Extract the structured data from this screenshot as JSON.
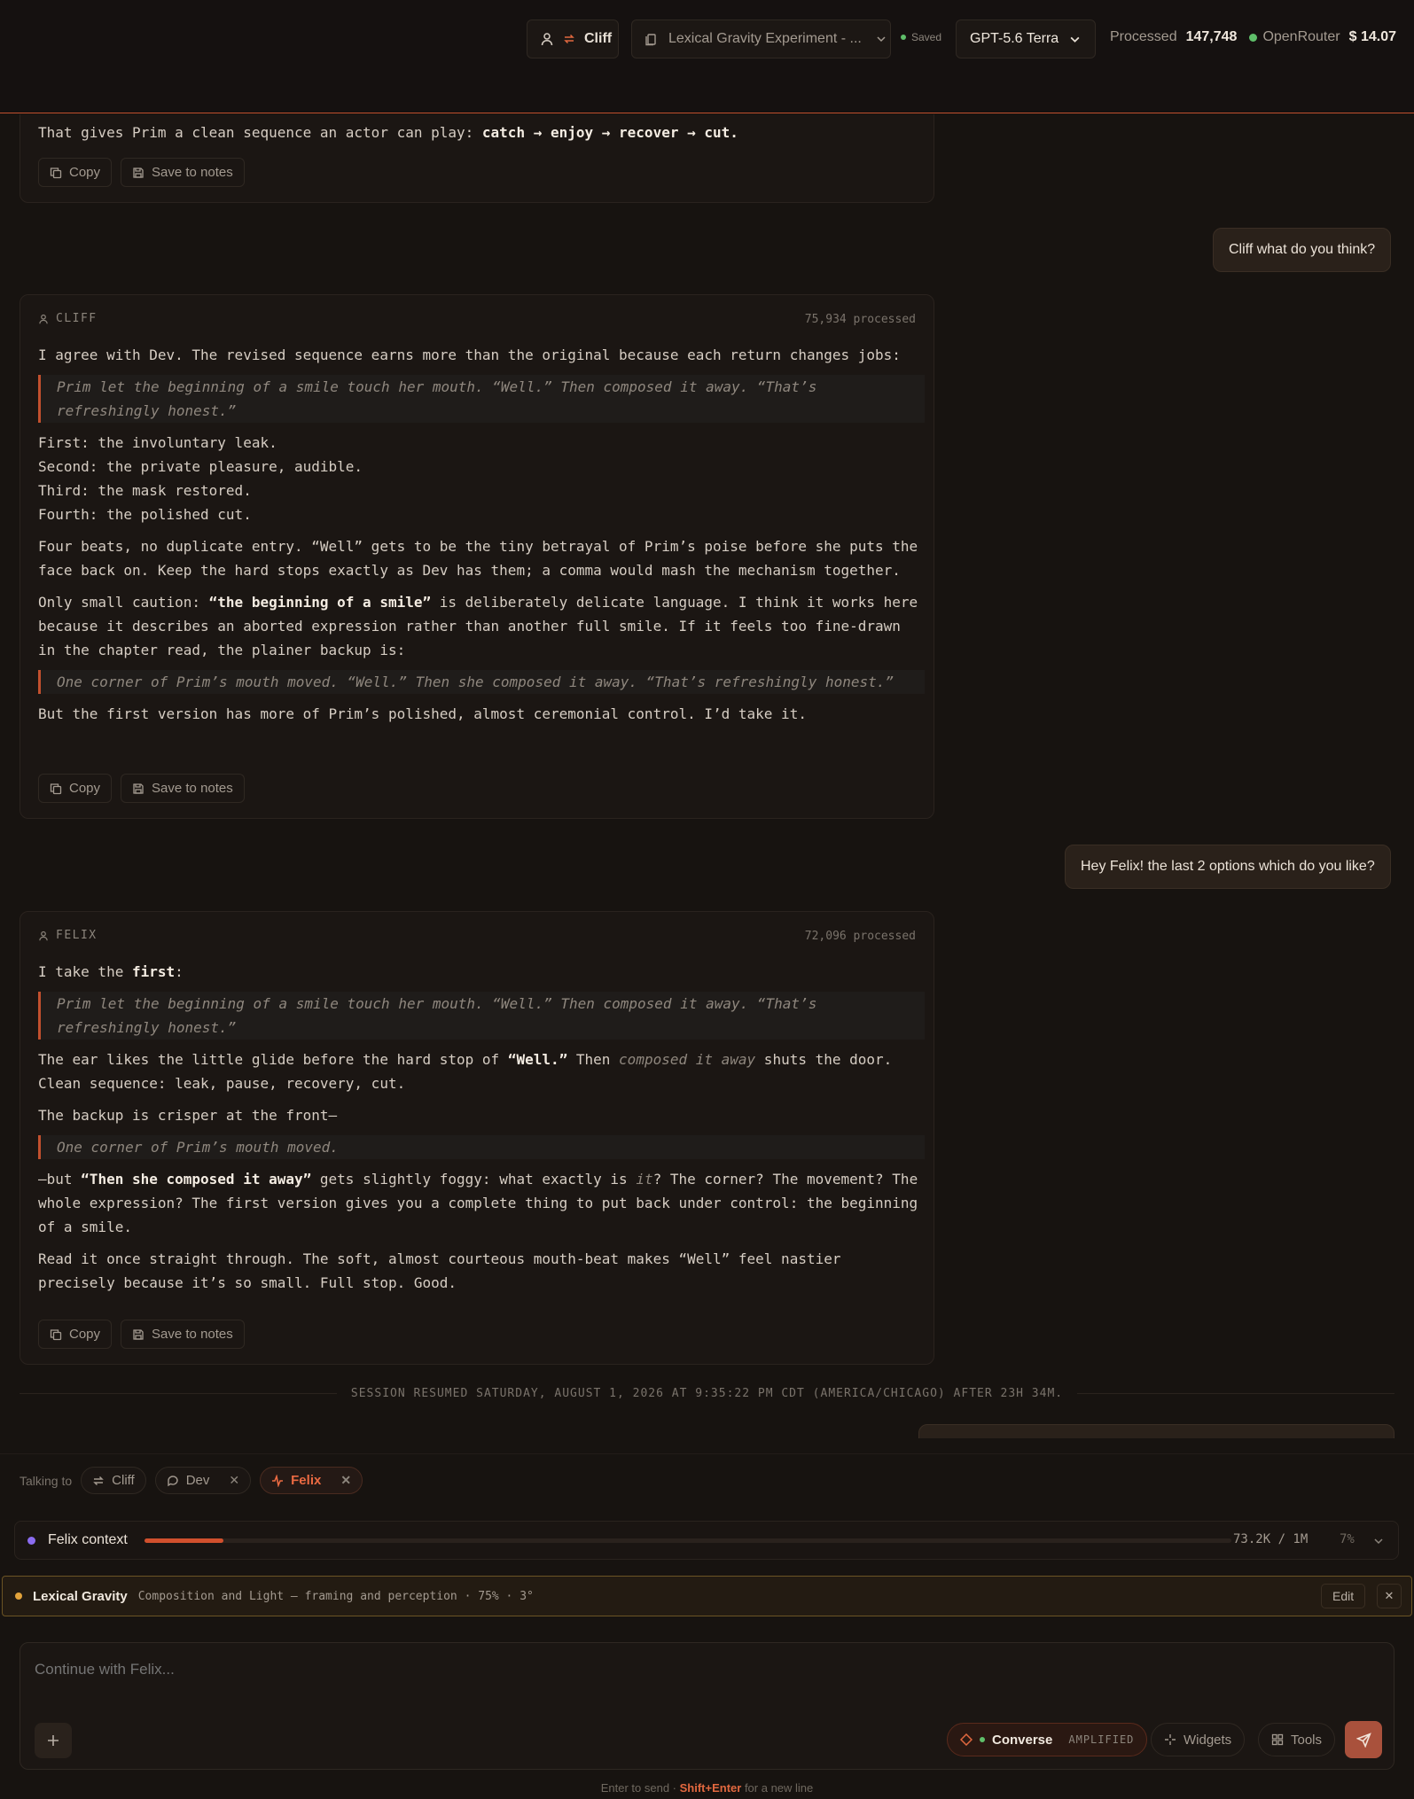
{
  "header": {
    "persona": "Cliff",
    "project": "Lexical Gravity Experiment - ...",
    "saved": "Saved",
    "model": "GPT-5.6 Terra",
    "processed_label": "Processed",
    "processed_value": "147,748",
    "provider": "OpenRouter",
    "cost": "$ 14.07"
  },
  "chat": {
    "top_card": {
      "text": "That gives Prim a clean sequence an actor can play: ",
      "bold": "catch → enjoy → recover → cut.",
      "copy": "Copy",
      "save": "Save to notes"
    },
    "user_msg_1": "Cliff what do you think?",
    "cliff": {
      "name": "CLIFF",
      "processed": "75,934 processed",
      "p1": "I agree with Dev. The revised sequence earns more than the original because each return changes jobs:",
      "q1": "Prim let the beginning of a smile touch her mouth. “Well.” Then composed it away. “That’s refreshingly honest.”",
      "l1": "First: the involuntary leak.",
      "l2": "Second: the private pleasure, audible.",
      "l3": "Third: the mask restored.",
      "l4": "Fourth: the polished cut.",
      "p2": "Four beats, no duplicate entry. “Well” gets to be the tiny betrayal of Prim’s poise before she puts the face back on. Keep the hard stops exactly as Dev has them; a comma would mash the mechanism together.",
      "p3a": "Only small caution: ",
      "p3b": "“the beginning of a smile”",
      "p3c": " is deliberately delicate language. I think it works here because it describes an aborted expression rather than another full smile. If it feels too fine-drawn in the chapter read, the plainer backup is:",
      "q2": "One corner of Prim’s mouth moved. “Well.” Then she composed it away. “That’s refreshingly honest.”",
      "p4": "But the first version has more of Prim’s polished, almost ceremonial control. I’d take it.",
      "copy": "Copy",
      "save": "Save to notes"
    },
    "user_msg_2": "Hey Felix! the last 2 options which do you like?",
    "felix": {
      "name": "FELIX",
      "processed": "72,096 processed",
      "p1a": "I take the ",
      "p1b": "first",
      "p1c": ":",
      "q1": "Prim let the beginning of a smile touch her mouth. “Well.” Then composed it away. “That’s refreshingly honest.”",
      "p2a": "The ear likes the little glide before the hard stop of ",
      "p2b": "“Well.”",
      "p2c": " Then ",
      "p2d": "composed it away",
      "p2e": " shuts the door. Clean sequence: leak, pause, recovery, cut.",
      "p3": "The backup is crisper at the front—",
      "q2": "One corner of Prim’s mouth moved.",
      "p4a": "—but ",
      "p4b": "“Then she composed it away”",
      "p4c": " gets slightly foggy: what exactly is ",
      "p4d": "it",
      "p4e": "? The corner? The movement? The whole expression? The first version gives you a complete thing to put back under control: the beginning of a smile.",
      "p5": "Read it once straight through. The soft, almost courteous mouth-beat makes “Well” feel nastier precisely because it’s so small. Full stop. Good.",
      "copy": "Copy",
      "save": "Save to notes"
    },
    "session": "SESSION RESUMED SATURDAY, AUGUST 1, 2026 AT 9:35:22 PM CDT (AMERICA/CHICAGO) AFTER 23H 34M."
  },
  "talking": {
    "label": "Talking to",
    "chips": [
      "Cliff",
      "Dev",
      "Felix"
    ]
  },
  "context": {
    "name": "Felix context",
    "value": "73.2K / 1M",
    "percent": "7%",
    "fill_fraction": 0.073
  },
  "lexical": {
    "name": "Lexical Gravity",
    "desc": "Composition and Light — framing and perception · 75% · 3°",
    "edit": "Edit"
  },
  "composer": {
    "placeholder": "Continue with Felix...",
    "mode": "Converse",
    "mode_tag": "AMPLIFIED",
    "widgets": "Widgets",
    "tools": "Tools"
  },
  "hint": {
    "a": "Enter to send · ",
    "b": "Shift+Enter",
    "c": " for a new line"
  },
  "colors": {
    "accent": "#d1502d",
    "ok": "#5fbf6a",
    "gold": "#e2a33b",
    "purple": "#8b6cf0"
  }
}
